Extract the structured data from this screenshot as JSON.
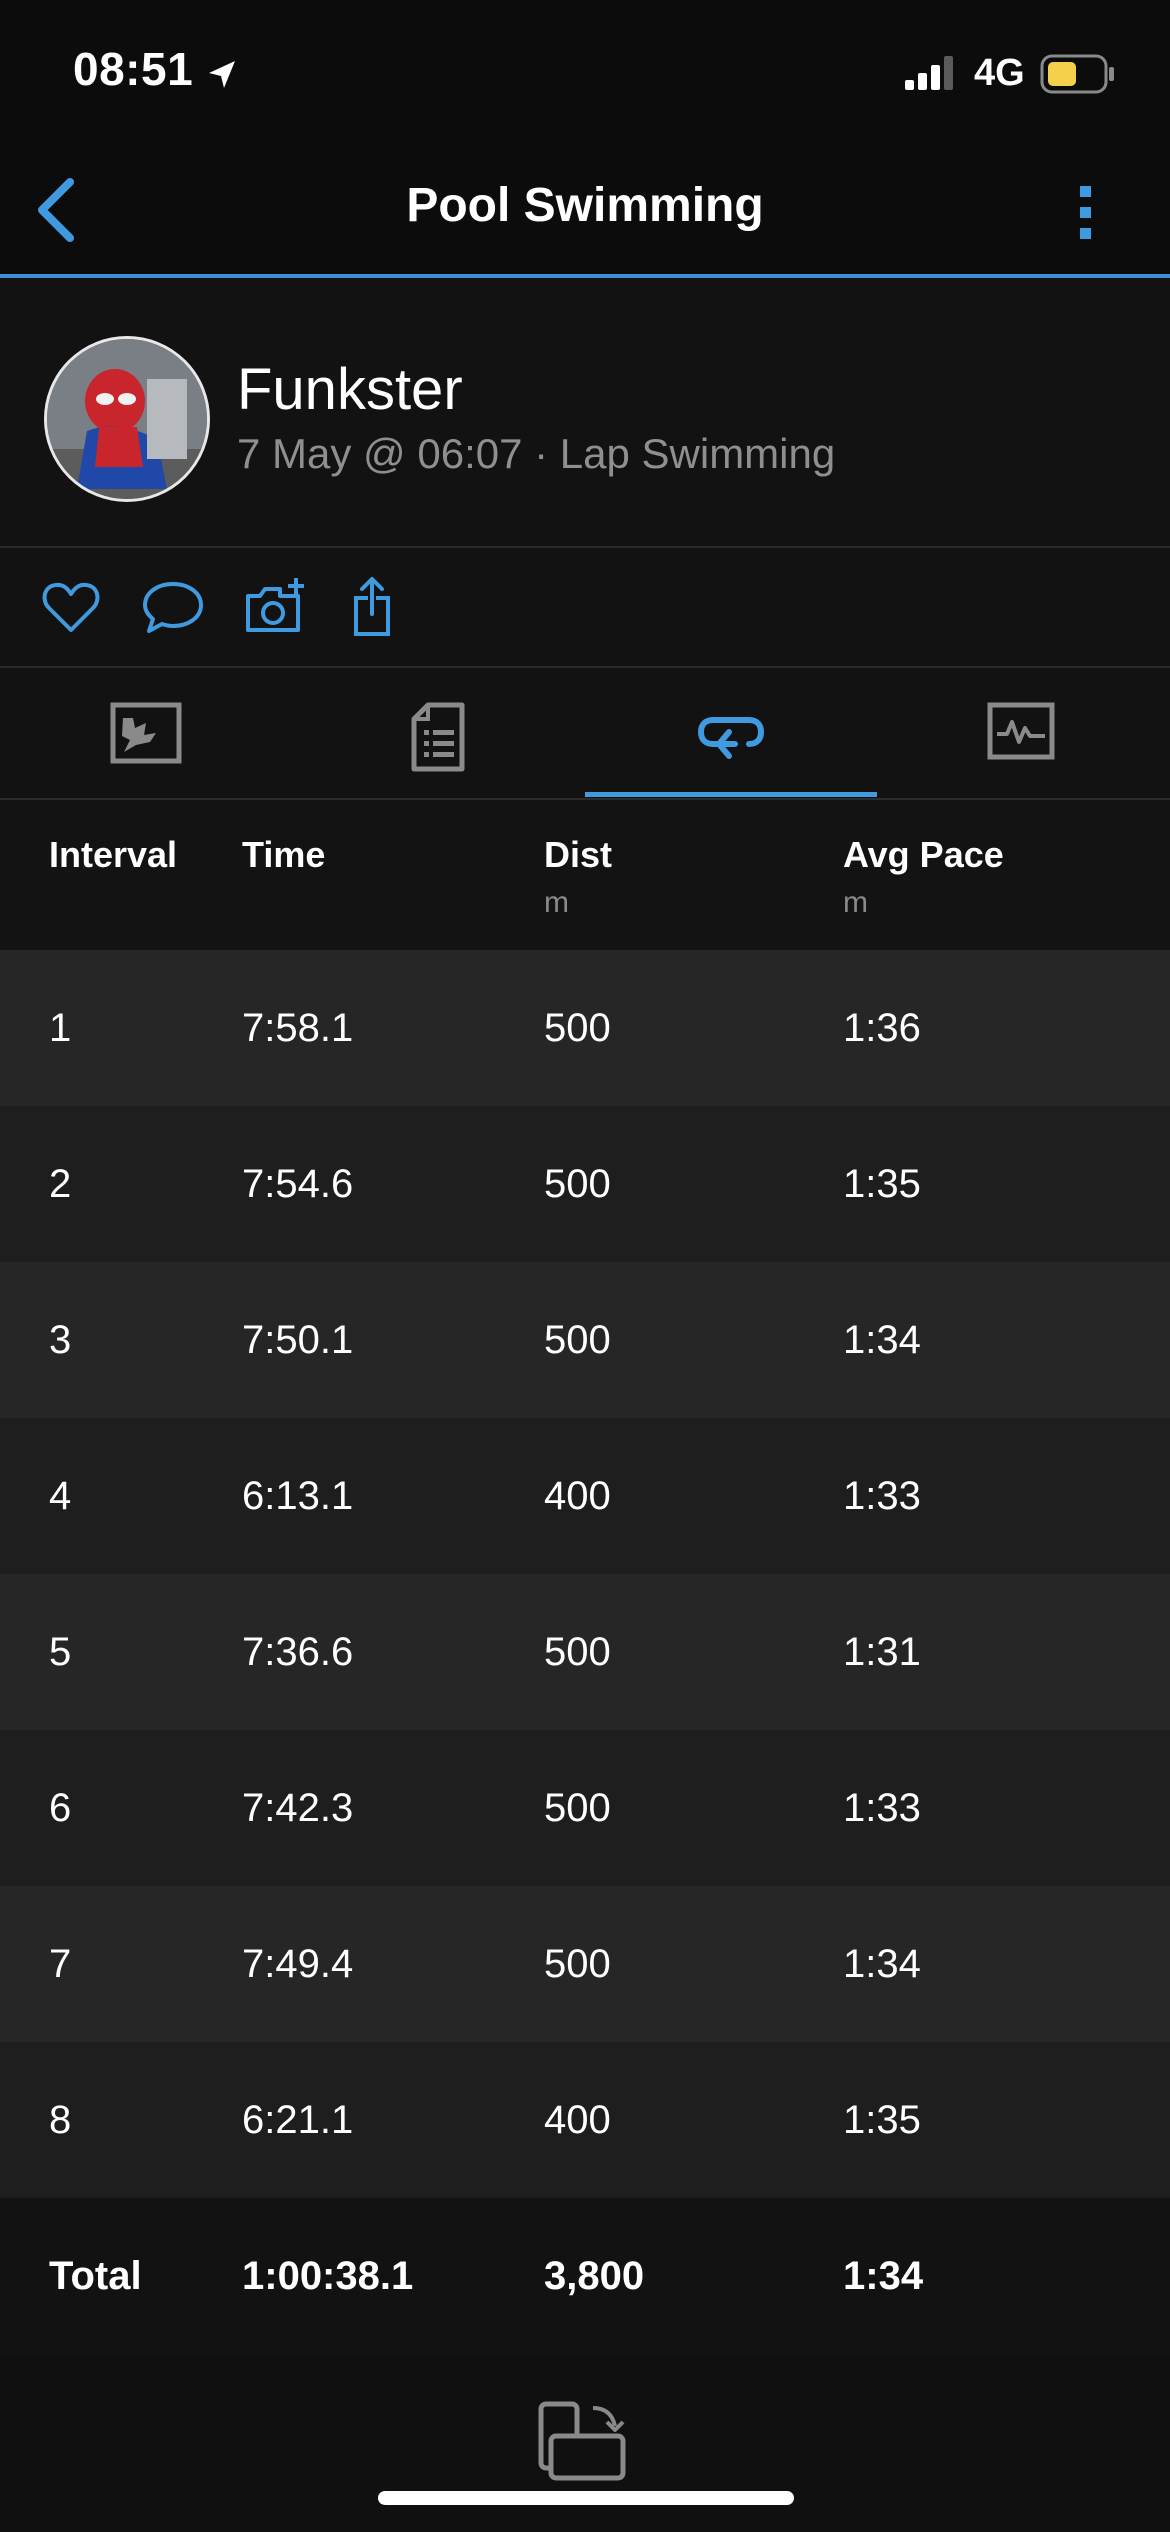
{
  "status_bar": {
    "time": "08:51",
    "network": "4G"
  },
  "nav": {
    "title": "Pool Swimming"
  },
  "profile": {
    "name": "Funkster",
    "meta": "7 May @ 06:07 · Lap Swimming"
  },
  "table": {
    "columns": [
      {
        "label": "Interval",
        "unit": ""
      },
      {
        "label": "Time",
        "unit": ""
      },
      {
        "label": "Dist",
        "unit": "m"
      },
      {
        "label": "Avg Pace",
        "unit": "m"
      }
    ],
    "rows": [
      {
        "interval": "1",
        "time": "7:58.1",
        "dist": "500",
        "pace": "1:36"
      },
      {
        "interval": "2",
        "time": "7:54.6",
        "dist": "500",
        "pace": "1:35"
      },
      {
        "interval": "3",
        "time": "7:50.1",
        "dist": "500",
        "pace": "1:34"
      },
      {
        "interval": "4",
        "time": "6:13.1",
        "dist": "400",
        "pace": "1:33"
      },
      {
        "interval": "5",
        "time": "7:36.6",
        "dist": "500",
        "pace": "1:31"
      },
      {
        "interval": "6",
        "time": "7:42.3",
        "dist": "500",
        "pace": "1:33"
      },
      {
        "interval": "7",
        "time": "7:49.4",
        "dist": "500",
        "pace": "1:34"
      },
      {
        "interval": "8",
        "time": "6:21.1",
        "dist": "400",
        "pace": "1:35"
      }
    ],
    "total": {
      "label": "Total",
      "time": "1:00:38.1",
      "dist": "3,800",
      "pace": "1:34"
    }
  },
  "colors": {
    "accent": "#3f9ae0",
    "background": "#101010",
    "battery": "#f5d04a"
  },
  "icons": [
    "location-arrow-icon",
    "signal-icon",
    "battery-icon",
    "chevron-left-icon",
    "more-vertical-icon",
    "heart-icon",
    "comment-icon",
    "add-photo-icon",
    "share-icon",
    "map-icon",
    "details-icon",
    "laps-icon",
    "chart-icon",
    "rotate-screen-icon"
  ]
}
